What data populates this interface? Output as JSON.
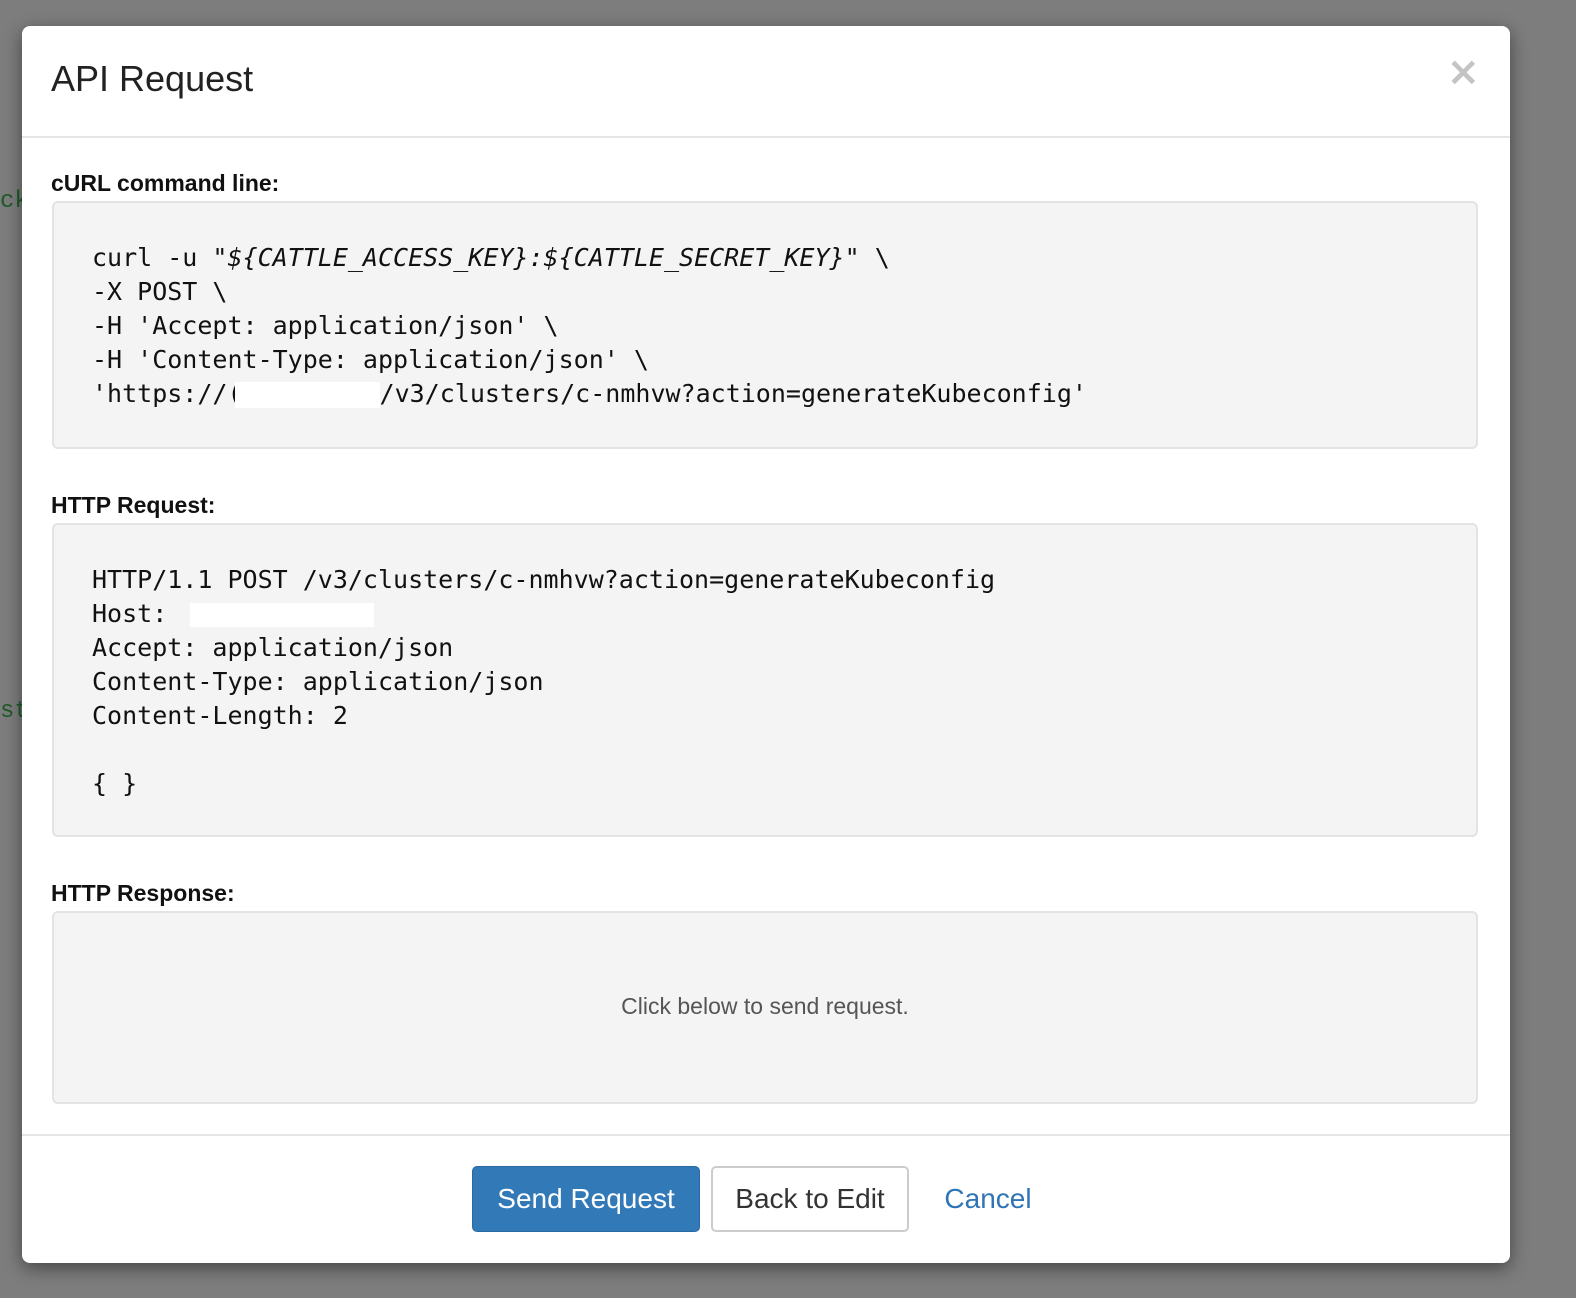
{
  "background": {
    "fragments": [
      "ck",
      "st"
    ]
  },
  "dialog": {
    "title": "API Request",
    "close_symbol": "×"
  },
  "curl": {
    "label": "cURL command line:",
    "line1_prefix": "curl -u ",
    "line1_italic": "\"${CATTLE_ACCESS_KEY}:${CATTLE_SECRET_KEY}\"",
    "line1_suffix": " \\",
    "line2": "-X POST \\",
    "line3": "-H 'Accept: application/json' \\",
    "line4": "-H 'Content-Type: application/json' \\",
    "line5_prefix": "'https://(",
    "line5_suffix": "/v3/clusters/c-nmhvw?action=generateKubeconfig'"
  },
  "http_request": {
    "label": "HTTP Request:",
    "line1": "HTTP/1.1 POST /v3/clusters/c-nmhvw?action=generateKubeconfig",
    "host_label": "Host: ",
    "line3": "Accept: application/json",
    "line4": "Content-Type: application/json",
    "line5": "Content-Length: 2",
    "body": "{ }"
  },
  "http_response": {
    "label": "HTTP Response:",
    "placeholder": "Click below to send request."
  },
  "footer": {
    "send_label": "Send Request",
    "back_label": "Back to Edit",
    "cancel_label": "Cancel"
  },
  "colors": {
    "primary": "#3279b7",
    "link": "#2f74b5",
    "code_bg": "#f4f4f4"
  }
}
